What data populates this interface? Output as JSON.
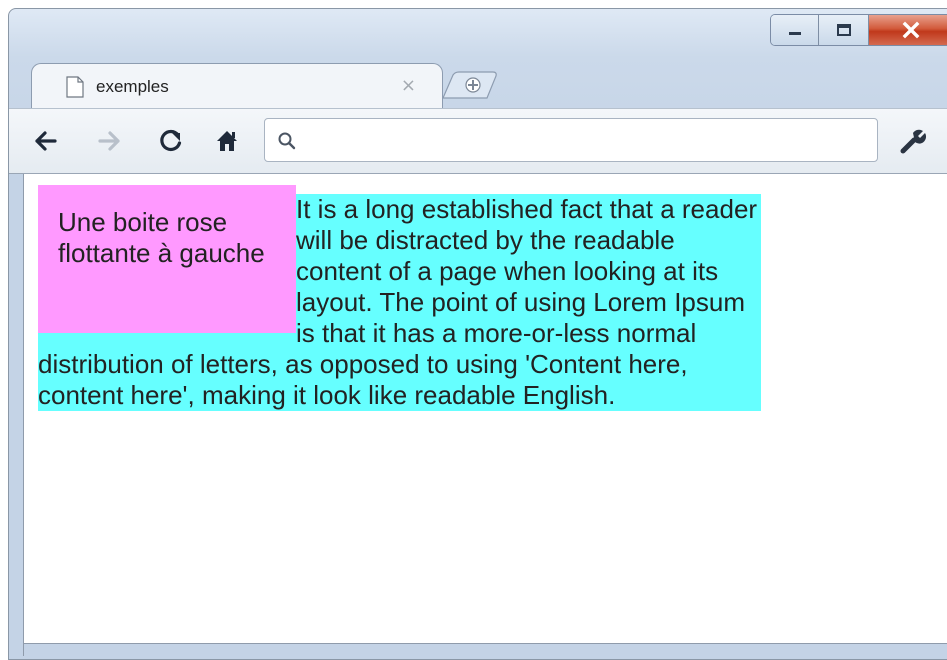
{
  "window": {
    "buttons": {
      "minimize": "minimize-icon",
      "maximize": "maximize-icon",
      "close": "close-icon"
    }
  },
  "tab": {
    "title": "exemples",
    "close": "×",
    "page_icon": "page-icon"
  },
  "toolbar": {
    "back": "back-arrow-icon",
    "forward": "forward-arrow-icon",
    "reload": "reload-icon",
    "home": "home-icon",
    "omnibox_value": "",
    "wrench": "wrench-icon"
  },
  "content": {
    "float_text": "Une boite rose flottante à gauche",
    "body_text": "It is a long established fact that a reader will be distracted by the readable content of a page when looking at its layout. The point of using Lorem Ipsum is that it has a more-or-less normal distribution of letters, as opposed to using 'Content here, content here', making it look like readable English."
  },
  "colors": {
    "float_bg": "#ff99ff",
    "content_bg": "#66ffff",
    "window_frame": "#c4d3e6"
  }
}
